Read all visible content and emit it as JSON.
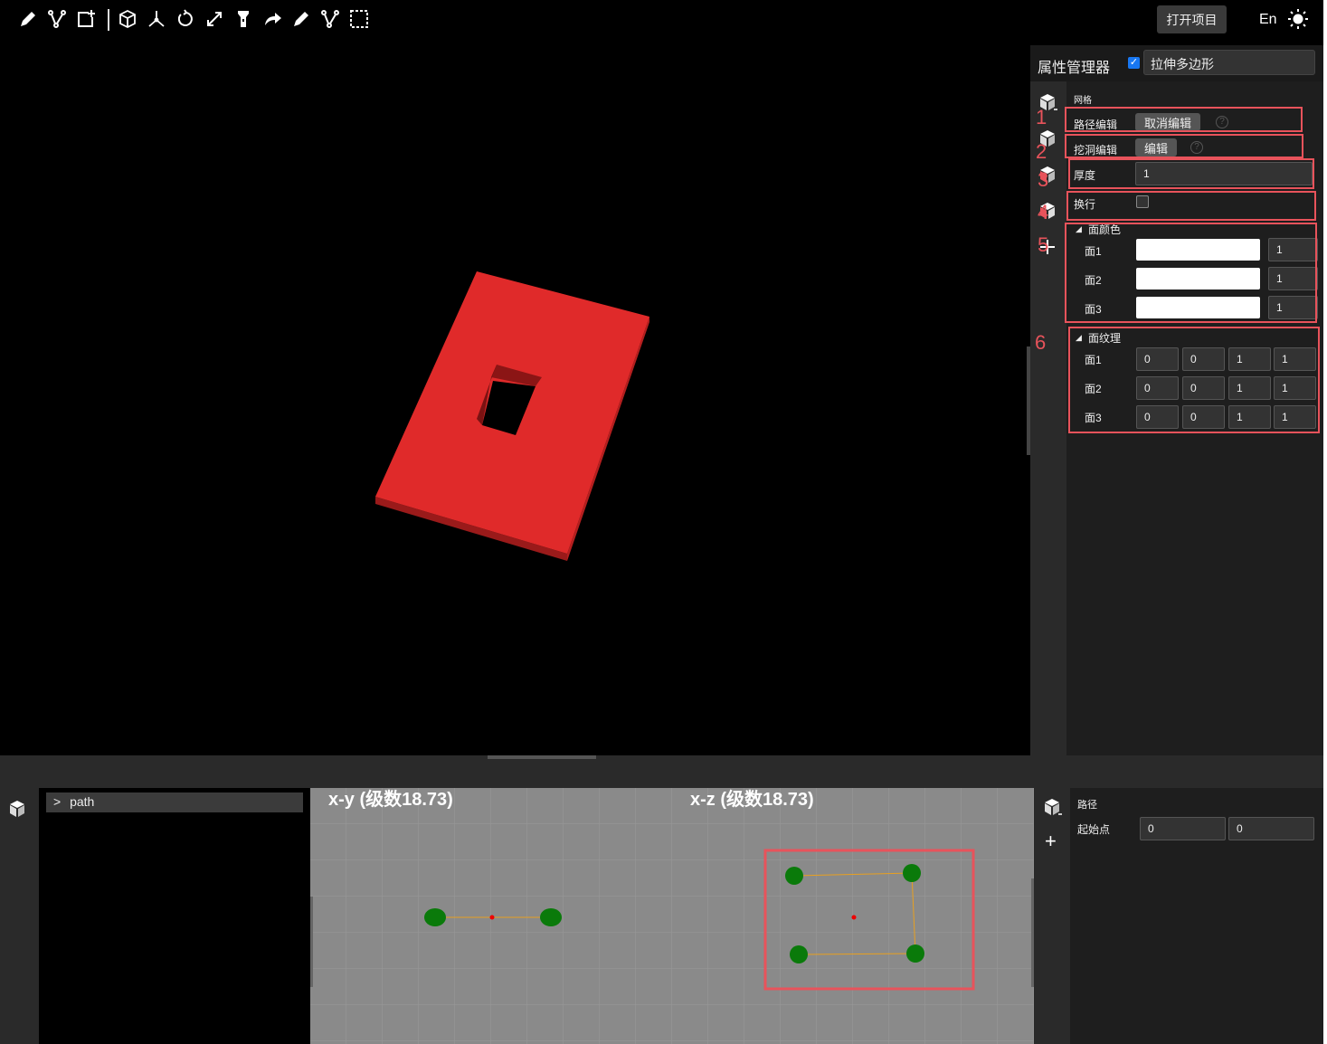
{
  "toolbar": {
    "icons": [
      "pencil-icon",
      "path-edit-icon",
      "add-shape-icon",
      "cube-icon",
      "axes-icon",
      "rotate-icon",
      "scale-icon",
      "flashlight-icon",
      "redo-arrow-icon",
      "pencil-icon",
      "branch-icon",
      "select-box-icon"
    ],
    "open_project": "打开项目",
    "language": "En",
    "theme_icon": "sun-icon"
  },
  "properties": {
    "title": "属性管理器",
    "object_name": "拉伸多边形",
    "object_enabled": true,
    "section_mesh": "网格",
    "path_edit_label": "路径编辑",
    "path_edit_button": "取消编辑",
    "hole_edit_label": "挖洞编辑",
    "hole_edit_button": "编辑",
    "thickness_label": "厚度",
    "thickness_value": "1",
    "wrap_label": "换行",
    "wrap_checked": false,
    "face_color_label": "面颜色",
    "face_colors": [
      {
        "label": "面1",
        "color": "#ffffff",
        "opacity": "1"
      },
      {
        "label": "面2",
        "color": "#ffffff",
        "opacity": "1"
      },
      {
        "label": "面3",
        "color": "#ffffff",
        "opacity": "1"
      }
    ],
    "face_texture_label": "面纹理",
    "face_textures": [
      {
        "label": "面1",
        "values": [
          "0",
          "0",
          "1",
          "1"
        ]
      },
      {
        "label": "面2",
        "values": [
          "0",
          "0",
          "1",
          "1"
        ]
      },
      {
        "label": "面3",
        "values": [
          "0",
          "0",
          "1",
          "1"
        ]
      }
    ],
    "help_glyph": "?"
  },
  "annotations": [
    "1",
    "2",
    "3",
    "4",
    "5",
    "6"
  ],
  "scene": {
    "shape_color": "#e02a2a"
  },
  "tree": {
    "item": "path",
    "expand_glyph": ">"
  },
  "views": {
    "xy_label": "x-y (级数18.73)",
    "xz_label": "x-z (级数18.73)"
  },
  "path_panel": {
    "section": "路径",
    "start_label": "起始点",
    "start_x": "0",
    "start_y": "0",
    "add_glyph": "+"
  }
}
